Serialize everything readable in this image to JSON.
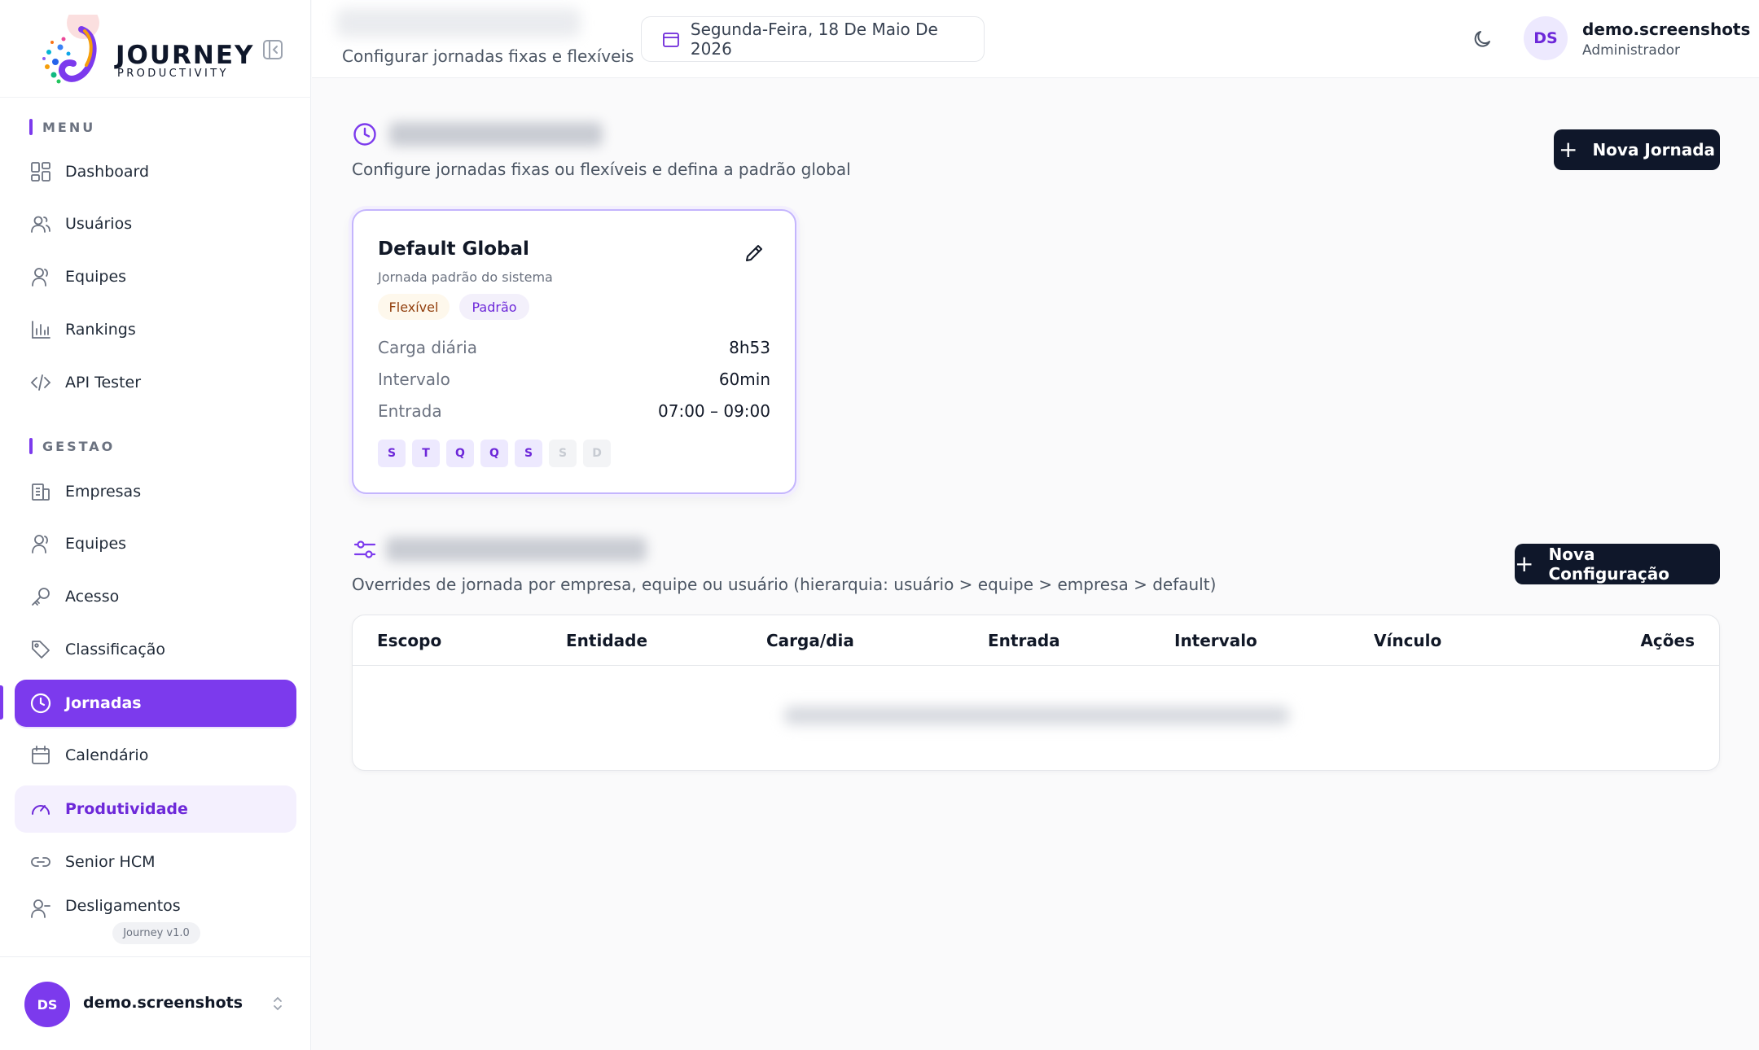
{
  "brand": {
    "title": "JOURNEY",
    "subtitle": "PRODUCTIVITY"
  },
  "sidebar": {
    "menu_label": "MENU",
    "menu_items": [
      {
        "label": "Dashboard",
        "icon": "dashboard-icon"
      },
      {
        "label": "Usuários",
        "icon": "users-icon"
      },
      {
        "label": "Equipes",
        "icon": "team-icon"
      },
      {
        "label": "Rankings",
        "icon": "bar-chart-icon"
      },
      {
        "label": "API Tester",
        "icon": "code-icon"
      }
    ],
    "gestao_label": "GESTAO",
    "gestao_items": [
      {
        "label": "Empresas",
        "icon": "building-icon"
      },
      {
        "label": "Equipes",
        "icon": "team-icon"
      },
      {
        "label": "Acesso",
        "icon": "key-icon"
      },
      {
        "label": "Classificação",
        "icon": "tag-icon"
      },
      {
        "label": "Jornadas",
        "icon": "clock-icon",
        "state": "active"
      },
      {
        "label": "Calendário",
        "icon": "calendar-icon"
      },
      {
        "label": "Produtividade",
        "icon": "gauge-icon",
        "state": "highlighted"
      },
      {
        "label": "Senior HCM",
        "icon": "link-icon"
      },
      {
        "label": "Desligamentos",
        "icon": "user-minus-icon"
      }
    ],
    "version": "Journey v1.0",
    "footer_user": {
      "initials": "DS",
      "name": "demo.screenshots"
    }
  },
  "topbar": {
    "subtitle": "Configurar jornadas fixas e flexíveis",
    "date": "Segunda-Feira, 18 De Maio De 2026",
    "user": {
      "initials": "DS",
      "name": "demo.screenshots",
      "role": "Administrador"
    }
  },
  "jornadas": {
    "description": "Configure jornadas fixas ou flexíveis e defina a padrão global",
    "new_button": "Nova Jornada",
    "card": {
      "title": "Default Global",
      "subtitle": "Jornada padrão do sistema",
      "badges": [
        "Flexível",
        "Padrão"
      ],
      "rows": [
        {
          "label": "Carga diária",
          "value": "8h53"
        },
        {
          "label": "Intervalo",
          "value": "60min"
        },
        {
          "label": "Entrada",
          "value": "07:00 – 09:00"
        }
      ],
      "days": [
        {
          "letter": "S",
          "active": true
        },
        {
          "letter": "T",
          "active": true
        },
        {
          "letter": "Q",
          "active": true
        },
        {
          "letter": "Q",
          "active": true
        },
        {
          "letter": "S",
          "active": true
        },
        {
          "letter": "S",
          "active": false
        },
        {
          "letter": "D",
          "active": false
        }
      ]
    }
  },
  "config": {
    "description": "Overrides de jornada por empresa, equipe ou usuário (hierarquia: usuário > equipe > empresa > default)",
    "new_button": "Nova Configuração",
    "columns": [
      "Escopo",
      "Entidade",
      "Carga/dia",
      "Entrada",
      "Intervalo",
      "Vínculo",
      "Ações"
    ]
  },
  "colors": {
    "accent": "#7c3aed",
    "dark_button": "#0f172a"
  }
}
